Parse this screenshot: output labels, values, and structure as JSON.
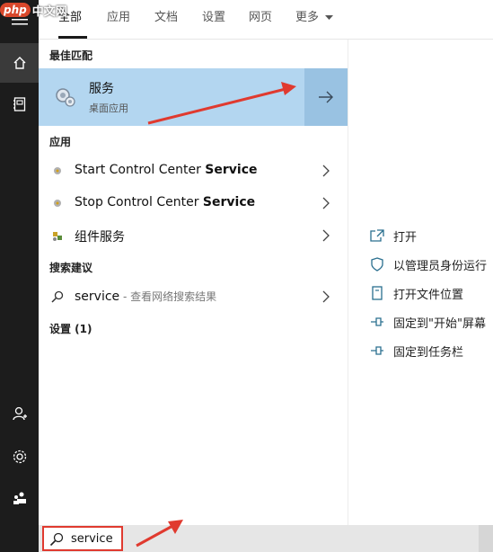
{
  "watermark": {
    "logo": "php",
    "text": "中文网"
  },
  "tabs": [
    "全部",
    "应用",
    "文档",
    "设置",
    "网页",
    "更多"
  ],
  "sections": {
    "best_match": "最佳匹配",
    "apps": "应用",
    "suggestions": "搜索建议",
    "settings": "设置 (1)"
  },
  "best_match": {
    "title": "服务",
    "subtitle": "桌面应用"
  },
  "apps": [
    {
      "prefix": "Start Control Center ",
      "bold": "Service"
    },
    {
      "prefix": "Stop Control Center ",
      "bold": "Service"
    },
    {
      "prefix": "组件服务",
      "bold": ""
    }
  ],
  "suggestion": {
    "term": "service",
    "suffix": " - 查看网络搜索结果"
  },
  "actions": [
    "打开",
    "以管理员身份运行",
    "打开文件位置",
    "固定到\"开始\"屏幕",
    "固定到任务栏"
  ],
  "search": {
    "value": "service"
  },
  "colors": {
    "accent_red": "#e03a2f",
    "selection": "#b3d6f0"
  }
}
